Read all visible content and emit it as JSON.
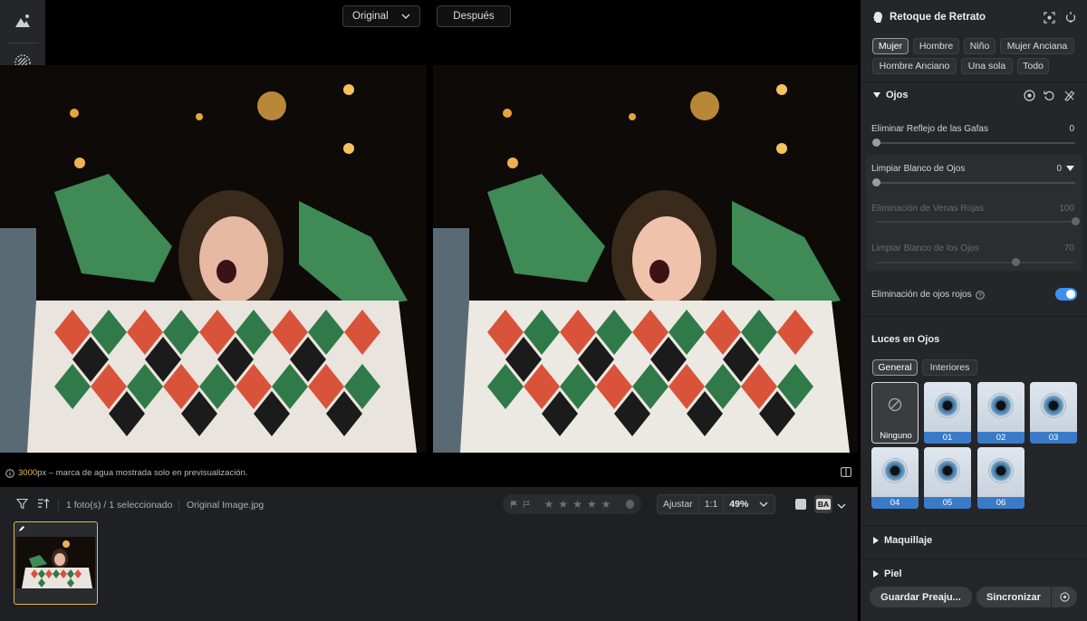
{
  "compare": {
    "original_label": "Original",
    "after_label": "Después"
  },
  "tools": [
    "ai-retouch-icon",
    "texture-icon",
    "history-icon"
  ],
  "watermark": {
    "px_value": "3000",
    "px_unit": "px",
    "message": " – marca de agua mostrada solo en previsualización."
  },
  "filmstrip": {
    "count_text": "1 foto(s) / 1 seleccionado",
    "filename": "Original Image.jpg",
    "fit_label": "Ajustar",
    "one_to_one_label": "1:1",
    "zoom_value": "49%",
    "ba_label": "BA",
    "stars": [
      "★",
      "★",
      "★",
      "★",
      "★"
    ]
  },
  "panel": {
    "title": "Retoque de Retrato",
    "presets": [
      {
        "label": "Mujer",
        "active": true
      },
      {
        "label": "Hombre",
        "active": false
      },
      {
        "label": "Niño",
        "active": false
      },
      {
        "label": "Mujer Anciana",
        "active": false
      },
      {
        "label": "Hombre Anciano",
        "active": false
      },
      {
        "label": "Una sola",
        "active": false
      },
      {
        "label": "Todo",
        "active": false
      }
    ],
    "eyes": {
      "title": "Ojos",
      "sliders": [
        {
          "label": "Eliminar Reflejo de las Gafas",
          "value": "0",
          "level": 0
        },
        {
          "label": "Limpiar Blanco de Ojos",
          "value": "0",
          "level": 0
        },
        {
          "label": "Eliminación de Venas Rojas",
          "value": "100",
          "level": 1.0
        },
        {
          "label": "Limpiar Blanco de los Ojos",
          "value": "70",
          "level": 0.7
        }
      ],
      "redeye_label": "Eliminación de ojos rojos",
      "redeye_on": true
    },
    "catchlights": {
      "title": "Luces en Ojos",
      "tabs": [
        {
          "label": "General",
          "active": true
        },
        {
          "label": "Interiores",
          "active": false
        }
      ],
      "items": [
        "Ninguno",
        "01",
        "02",
        "03",
        "04",
        "05",
        "06"
      ]
    },
    "makeup_title": "Maquillaje",
    "next_title": "Piel",
    "save_label": "Guardar Preaju...",
    "sync_label": "Sincronizar"
  }
}
